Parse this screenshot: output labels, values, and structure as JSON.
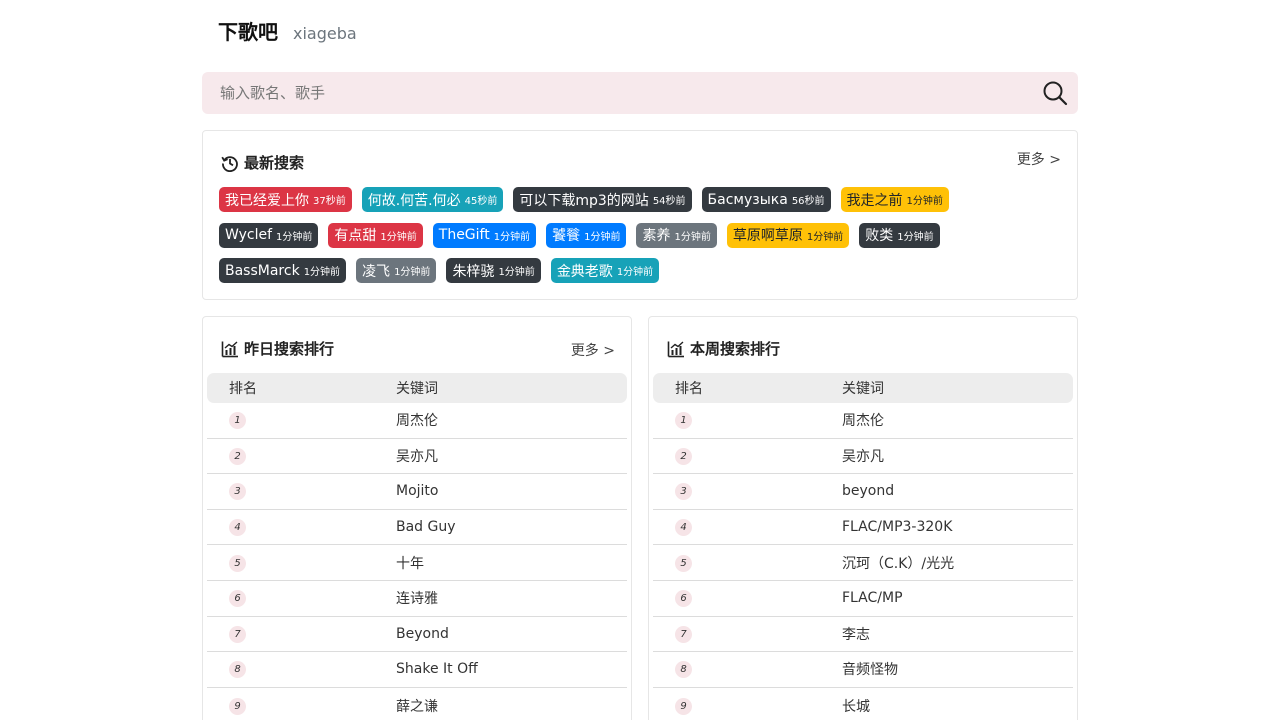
{
  "site": {
    "name": "下歌吧",
    "subtitle": "xiageba"
  },
  "search": {
    "placeholder": "输入歌名、歌手",
    "value": ""
  },
  "latest": {
    "title": "最新搜索",
    "more": "更多 >",
    "rows": [
      [
        {
          "text": "我已经爱上你",
          "time": "37秒前",
          "color": "red"
        },
        {
          "text": "何故.何苦.何必",
          "time": "45秒前",
          "color": "teal"
        },
        {
          "text": "可以下载mp3的网站",
          "time": "54秒前",
          "color": "dark"
        },
        {
          "text": "Басмузыка",
          "time": "56秒前",
          "color": "dark"
        },
        {
          "text": "我走之前",
          "time": "1分钟前",
          "color": "yellow"
        }
      ],
      [
        {
          "text": "Wyclef",
          "time": "1分钟前",
          "color": "dark"
        },
        {
          "text": "有点甜",
          "time": "1分钟前",
          "color": "red"
        },
        {
          "text": "TheGift",
          "time": "1分钟前",
          "color": "blue"
        },
        {
          "text": "饕餮",
          "time": "1分钟前",
          "color": "blue"
        },
        {
          "text": "素养",
          "time": "1分钟前",
          "color": "gray"
        },
        {
          "text": "草原啊草原",
          "time": "1分钟前",
          "color": "yellow"
        },
        {
          "text": "败类",
          "time": "1分钟前",
          "color": "dark"
        }
      ],
      [
        {
          "text": "BassMarck",
          "time": "1分钟前",
          "color": "dark"
        },
        {
          "text": "凌飞",
          "time": "1分钟前",
          "color": "gray"
        },
        {
          "text": "朱梓骁",
          "time": "1分钟前",
          "color": "dark"
        },
        {
          "text": "金典老歌",
          "time": "1分钟前",
          "color": "teal"
        }
      ]
    ]
  },
  "yesterday": {
    "title": "昨日搜索排行",
    "more": "更多 >",
    "headers": [
      "排名",
      "关键词"
    ],
    "rows": [
      {
        "rank": "1",
        "keyword": "周杰伦"
      },
      {
        "rank": "2",
        "keyword": "吴亦凡"
      },
      {
        "rank": "3",
        "keyword": "Mojito"
      },
      {
        "rank": "4",
        "keyword": "Bad Guy"
      },
      {
        "rank": "5",
        "keyword": "十年"
      },
      {
        "rank": "6",
        "keyword": "连诗雅"
      },
      {
        "rank": "7",
        "keyword": "Beyond"
      },
      {
        "rank": "8",
        "keyword": "Shake It Off"
      },
      {
        "rank": "9",
        "keyword": "薛之谦"
      }
    ]
  },
  "week": {
    "title": "本周搜索排行",
    "headers": [
      "排名",
      "关键词"
    ],
    "rows": [
      {
        "rank": "1",
        "keyword": "周杰伦"
      },
      {
        "rank": "2",
        "keyword": "吴亦凡"
      },
      {
        "rank": "3",
        "keyword": "beyond"
      },
      {
        "rank": "4",
        "keyword": "FLAC/MP3-320K"
      },
      {
        "rank": "5",
        "keyword": "沉珂（C.K）/光光"
      },
      {
        "rank": "6",
        "keyword": "FLAC/MP"
      },
      {
        "rank": "7",
        "keyword": "李志"
      },
      {
        "rank": "8",
        "keyword": "音频怪物"
      },
      {
        "rank": "9",
        "keyword": "长城"
      }
    ]
  }
}
